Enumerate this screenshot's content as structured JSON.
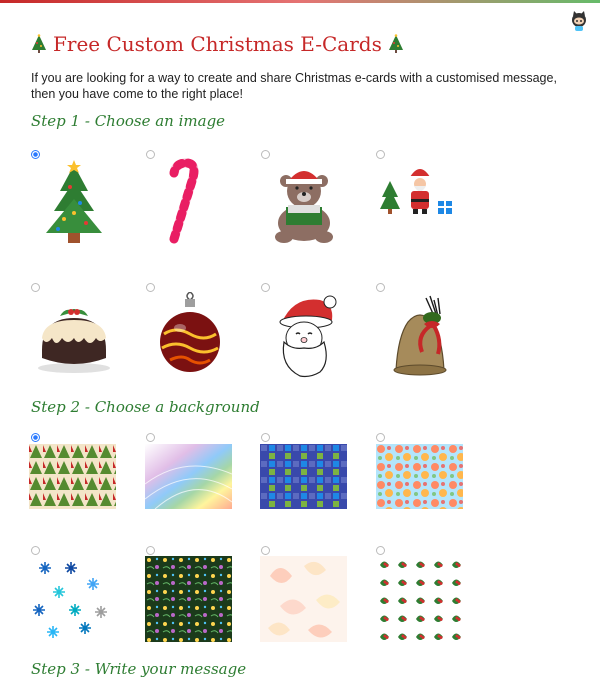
{
  "header": {
    "title": "Free Custom Christmas E-Cards",
    "intro": "If you are looking for a way to create and share Christmas e-cards with a customised message, then you have come to the right place!"
  },
  "steps": {
    "step1": "Step 1 - Choose an image",
    "step2": "Step 2 - Choose a background",
    "step3": "Step 3 - Write your message"
  },
  "images": [
    {
      "name": "christmas-tree",
      "selected": true
    },
    {
      "name": "candy-cane",
      "selected": false
    },
    {
      "name": "teddy-bear",
      "selected": false
    },
    {
      "name": "santa-with-tree-and-gift",
      "selected": false
    },
    {
      "name": "christmas-pudding",
      "selected": false
    },
    {
      "name": "bauble",
      "selected": false
    },
    {
      "name": "santa-face",
      "selected": false
    },
    {
      "name": "bell",
      "selected": false
    }
  ],
  "backgrounds": [
    {
      "name": "trees-pattern",
      "selected": true
    },
    {
      "name": "rainbow-pattern",
      "selected": false
    },
    {
      "name": "blue-squares-pattern",
      "selected": false
    },
    {
      "name": "poinsettia-pattern",
      "selected": false
    },
    {
      "name": "snowflakes-pattern",
      "selected": false
    },
    {
      "name": "dark-floral-pattern",
      "selected": false
    },
    {
      "name": "faded-leaves-pattern",
      "selected": false
    },
    {
      "name": "holly-pattern",
      "selected": false
    }
  ],
  "colors": {
    "title": "#c62828",
    "heading": "#2e7d32",
    "radio": "#2979ff"
  }
}
